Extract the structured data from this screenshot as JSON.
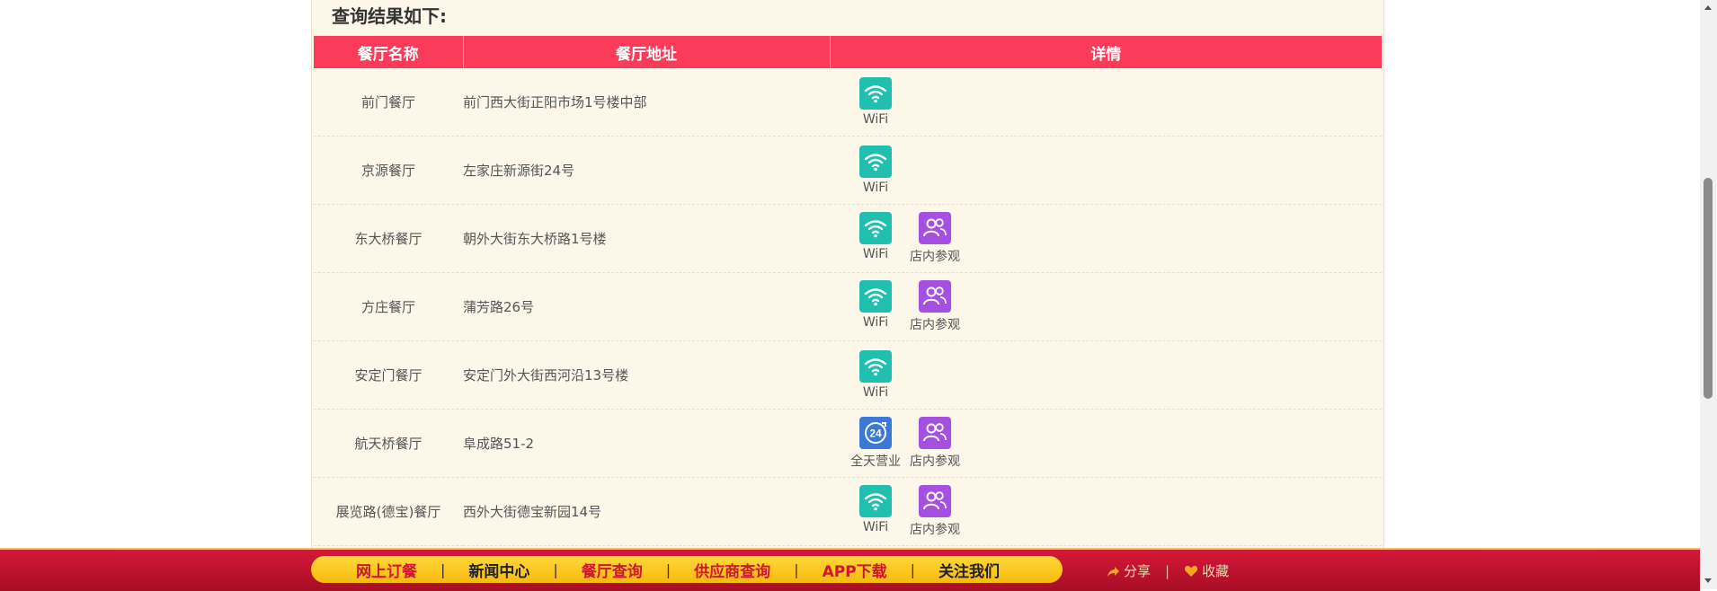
{
  "result_title": "查询结果如下:",
  "table": {
    "headers": [
      "餐厅名称",
      "餐厅地址",
      "详情"
    ],
    "rows": [
      {
        "name": "前门餐厅",
        "address": "前门西大街正阳市场1号楼中部",
        "features": [
          {
            "type": "wifi",
            "label": "WiFi"
          }
        ]
      },
      {
        "name": "京源餐厅",
        "address": "左家庄新源街24号",
        "features": [
          {
            "type": "wifi",
            "label": "WiFi"
          }
        ]
      },
      {
        "name": "东大桥餐厅",
        "address": "朝外大街东大桥路1号楼",
        "features": [
          {
            "type": "wifi",
            "label": "WiFi"
          },
          {
            "type": "tour",
            "label": "店内参观"
          }
        ]
      },
      {
        "name": "方庄餐厅",
        "address": "蒲芳路26号",
        "features": [
          {
            "type": "wifi",
            "label": "WiFi"
          },
          {
            "type": "tour",
            "label": "店内参观"
          }
        ]
      },
      {
        "name": "安定门餐厅",
        "address": "安定门外大街西河沿13号楼",
        "features": [
          {
            "type": "wifi",
            "label": "WiFi"
          }
        ]
      },
      {
        "name": "航天桥餐厅",
        "address": "阜成路51-2",
        "features": [
          {
            "type": "hours",
            "label": "全天营业"
          },
          {
            "type": "tour",
            "label": "店内参观"
          }
        ]
      },
      {
        "name": "展览路(德宝)餐厅",
        "address": "西外大街德宝新园14号",
        "features": [
          {
            "type": "wifi",
            "label": "WiFi"
          },
          {
            "type": "tour",
            "label": "店内参观"
          }
        ]
      }
    ]
  },
  "footer": {
    "nav": [
      {
        "label": "网上订餐",
        "color": "red"
      },
      {
        "label": "新闻中心",
        "color": "dark"
      },
      {
        "label": "餐厅查询",
        "color": "red"
      },
      {
        "label": "供应商查询",
        "color": "red"
      },
      {
        "label": "APP下载",
        "color": "red"
      },
      {
        "label": "关注我们",
        "color": "dark"
      }
    ],
    "separator": "|",
    "share_label": "分享",
    "favorite_label": "收藏"
  },
  "colors": {
    "header_red": "#fa3c5a",
    "wifi_teal": "#20bfae",
    "tour_purple": "#a550e0",
    "hours_blue": "#3b79d8",
    "footer_red": "#c0112c",
    "nav_yellow": "#fbc520"
  }
}
